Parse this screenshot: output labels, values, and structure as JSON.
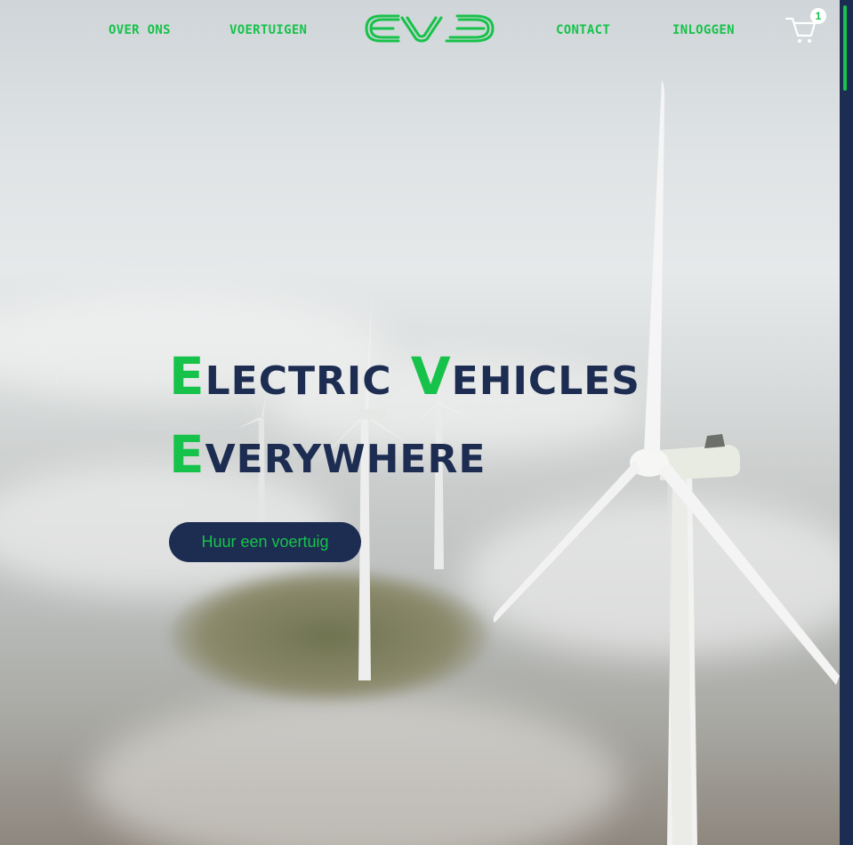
{
  "nav": {
    "links": [
      "Over ons",
      "Voertuigen",
      "Contact",
      "Inloggen"
    ],
    "logo_text": "EVE",
    "cart": {
      "icon": "shopping-cart-icon",
      "count": "1"
    }
  },
  "hero": {
    "line1_word1_initial": "E",
    "line1_word1_rest": "LECTRIC",
    "line1_word2_initial": "V",
    "line1_word2_rest": "EHICLES",
    "line2_initial": "E",
    "line2_rest": "VERYWHERE",
    "cta_label": "Huur een voertuig",
    "background": "wind turbines above fog"
  },
  "colors": {
    "accent": "#17c24a",
    "navy": "#1d2d52",
    "white": "#ffffff"
  }
}
